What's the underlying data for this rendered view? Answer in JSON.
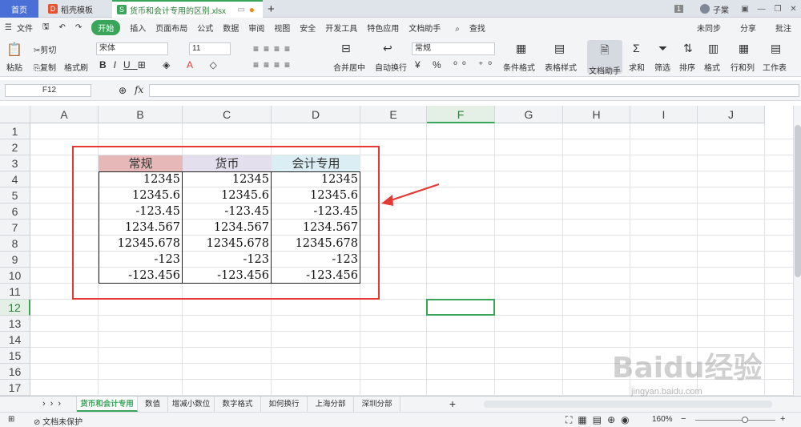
{
  "tabs": {
    "home": "首页",
    "template": "稻壳模板",
    "file": "货币和会计专用的区别.xlsx"
  },
  "titlebar": {
    "page_badge": "1",
    "user": "子棠"
  },
  "menu": {
    "file": "文件",
    "items": [
      "开始",
      "插入",
      "页面布局",
      "公式",
      "数据",
      "审阅",
      "视图",
      "安全",
      "开发工具",
      "特色应用",
      "文档助手"
    ],
    "search": "查找",
    "sync": "未同步",
    "share": "分享",
    "comment": "批注"
  },
  "ribbon": {
    "paste": "粘贴",
    "cut": "剪切",
    "copy": "复制",
    "format_painter": "格式刷",
    "font_name": "宋体",
    "font_size": "11",
    "merge_center": "合并居中",
    "wrap_text": "自动换行",
    "number_format": "常规",
    "conditional_format": "条件格式",
    "table_style": "表格样式",
    "doc_helper": "文档助手",
    "sum": "求和",
    "filter": "筛选",
    "sort": "排序",
    "format": "格式",
    "row_col": "行和列",
    "worksheet": "工作表"
  },
  "formula_bar": {
    "cell_ref": "F12",
    "fx": "fx",
    "content": ""
  },
  "columns": [
    "A",
    "B",
    "C",
    "D",
    "E",
    "F",
    "G",
    "H",
    "I",
    "J"
  ],
  "rows": [
    "1",
    "2",
    "3",
    "4",
    "5",
    "6",
    "7",
    "8",
    "9",
    "10",
    "11",
    "12",
    "13",
    "14",
    "15",
    "16",
    "17"
  ],
  "table": {
    "headers": [
      "常规",
      "货币",
      "会计专用"
    ],
    "header_colors": [
      "#e6b8b7",
      "#e4dfec",
      "#daeef3"
    ],
    "rows": [
      [
        "12345",
        "12345",
        "12345"
      ],
      [
        "12345.6",
        "12345.6",
        "12345.6"
      ],
      [
        "-123.45",
        "-123.45",
        "-123.45"
      ],
      [
        "1234.567",
        "1234.567",
        "1234.567"
      ],
      [
        "12345.678",
        "12345.678",
        "12345.678"
      ],
      [
        "-123",
        "-123",
        "-123"
      ],
      [
        "-123.456",
        "-123.456",
        "-123.456"
      ]
    ]
  },
  "annotation_color": "#e53935",
  "sheets": [
    "货币和会计专用",
    "数值",
    "增减小数位",
    "数字格式",
    "如何换行",
    "上海分部",
    "深圳分部"
  ],
  "active_sheet_color": "#3aa55a",
  "status": {
    "doc_protect": "文档未保护",
    "zoom": "160%"
  },
  "watermark": {
    "brand": "Baidu经验",
    "url": "jingyan.baidu.com"
  }
}
